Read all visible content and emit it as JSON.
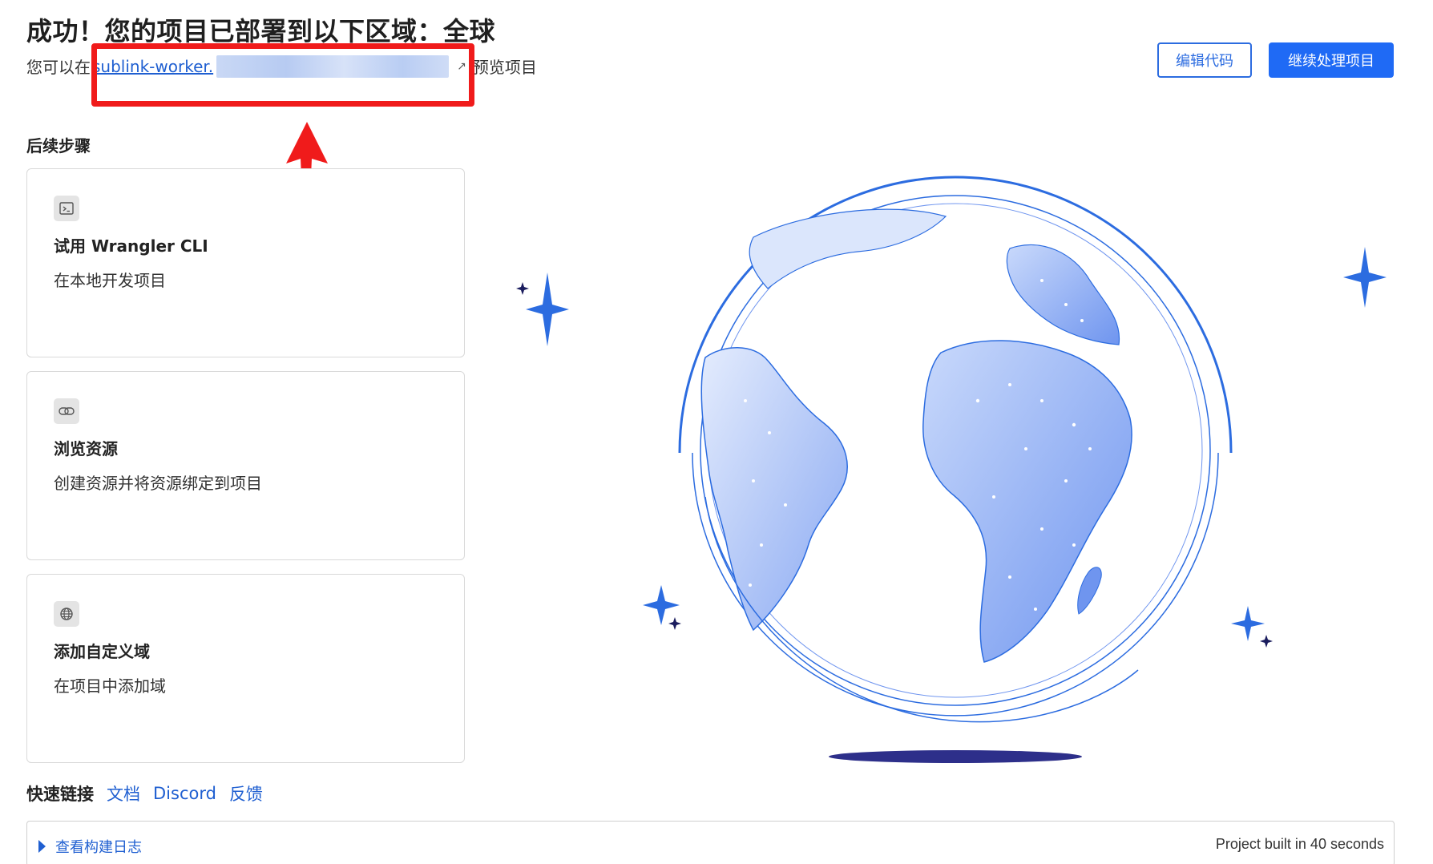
{
  "header": {
    "title": "成功！您的项目已部署到以下区域：全球",
    "subtitle_prefix": "您可以在",
    "link_text": "sublink-worker.",
    "subtitle_suffix": "预览项目"
  },
  "actions": {
    "edit_label": "编辑代码",
    "continue_label": "继续处理项目"
  },
  "next_steps": {
    "title": "后续步骤",
    "cards": [
      {
        "title": "试用 Wrangler CLI",
        "desc": "在本地开发项目",
        "icon": "terminal-icon"
      },
      {
        "title": "浏览资源",
        "desc": "创建资源并将资源绑定到项目",
        "icon": "link-icon"
      },
      {
        "title": "添加自定义域",
        "desc": "在项目中添加域",
        "icon": "globe-icon"
      }
    ]
  },
  "quick_links": {
    "label": "快速链接",
    "items": [
      "文档",
      "Discord",
      "反馈"
    ]
  },
  "build_log": {
    "toggle_label": "查看构建日志",
    "built_text": "Project built in 40 seconds"
  },
  "colors": {
    "accent": "#1f6af5",
    "link": "#1f5fd1",
    "highlight": "#f01b1b"
  }
}
